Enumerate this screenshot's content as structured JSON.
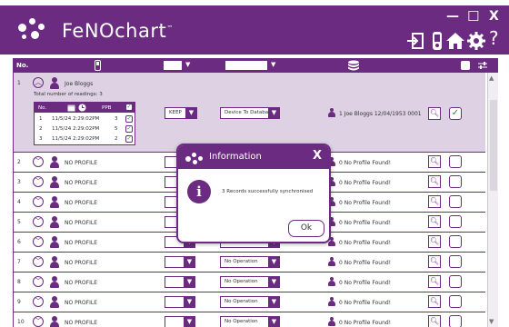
{
  "app": {
    "title": "FeNOchart",
    "trademark": "™"
  },
  "window_controls": {
    "minimize": "—",
    "maximize": "☐",
    "close": "X"
  },
  "header_icons": [
    "logout-icon",
    "device-icon",
    "home-icon",
    "settings-icon",
    "help-icon"
  ],
  "help_glyph": "?",
  "table_header": {
    "no_label": "No."
  },
  "expanded_row": {
    "num": "1",
    "name": "Joe Bloggs",
    "readings_total_label": "Total number of readings: 3",
    "readings_header": {
      "no": "No.",
      "ppb": "PPB"
    },
    "readings": [
      {
        "n": "1",
        "date": "11/5/24",
        "time": "2:29:02PM",
        "ppb": "3"
      },
      {
        "n": "2",
        "date": "11/5/24",
        "time": "2:29:02PM",
        "ppb": "5"
      },
      {
        "n": "3",
        "date": "11/5/24",
        "time": "2:29:02PM",
        "ppb": "2"
      }
    ],
    "mode_value": "KEEP",
    "operation_value": "Device To Database",
    "patient_info": "1 Joe Bloggs 12/04/1953 0001"
  },
  "rows": [
    {
      "num": "2",
      "name": "NO PROFILE",
      "operation": "",
      "status": "0 No Profile Found!"
    },
    {
      "num": "3",
      "name": "NO PROFILE",
      "operation": "",
      "status": "0 No Profile Found!"
    },
    {
      "num": "4",
      "name": "NO PROFILE",
      "operation": "",
      "status": "0 No Profile Found!"
    },
    {
      "num": "5",
      "name": "NO PROFILE",
      "operation": "",
      "status": "0 No Profile Found!"
    },
    {
      "num": "6",
      "name": "NO PROFILE",
      "operation": "No Operation",
      "status": "0 No Profile Found!"
    },
    {
      "num": "7",
      "name": "NO PROFILE",
      "operation": "No Operation",
      "status": "0 No Profile Found!"
    },
    {
      "num": "8",
      "name": "NO PROFILE",
      "operation": "No Operation",
      "status": "0 No Profile Found!"
    },
    {
      "num": "9",
      "name": "NO PROFILE",
      "operation": "No Operation",
      "status": "0 No Profile Found!"
    },
    {
      "num": "10",
      "name": "NO PROFILE",
      "operation": "No Operation",
      "status": "0 No Profile Found!"
    }
  ],
  "dialog": {
    "title": "Information",
    "close": "X",
    "icon_glyph": "i",
    "message": "3 Records successfully synchronised",
    "ok_label": "Ok"
  },
  "colors": {
    "brand": "#6a2b80",
    "row_selected": "#ddd1e3",
    "check": "#2a8b2a"
  }
}
